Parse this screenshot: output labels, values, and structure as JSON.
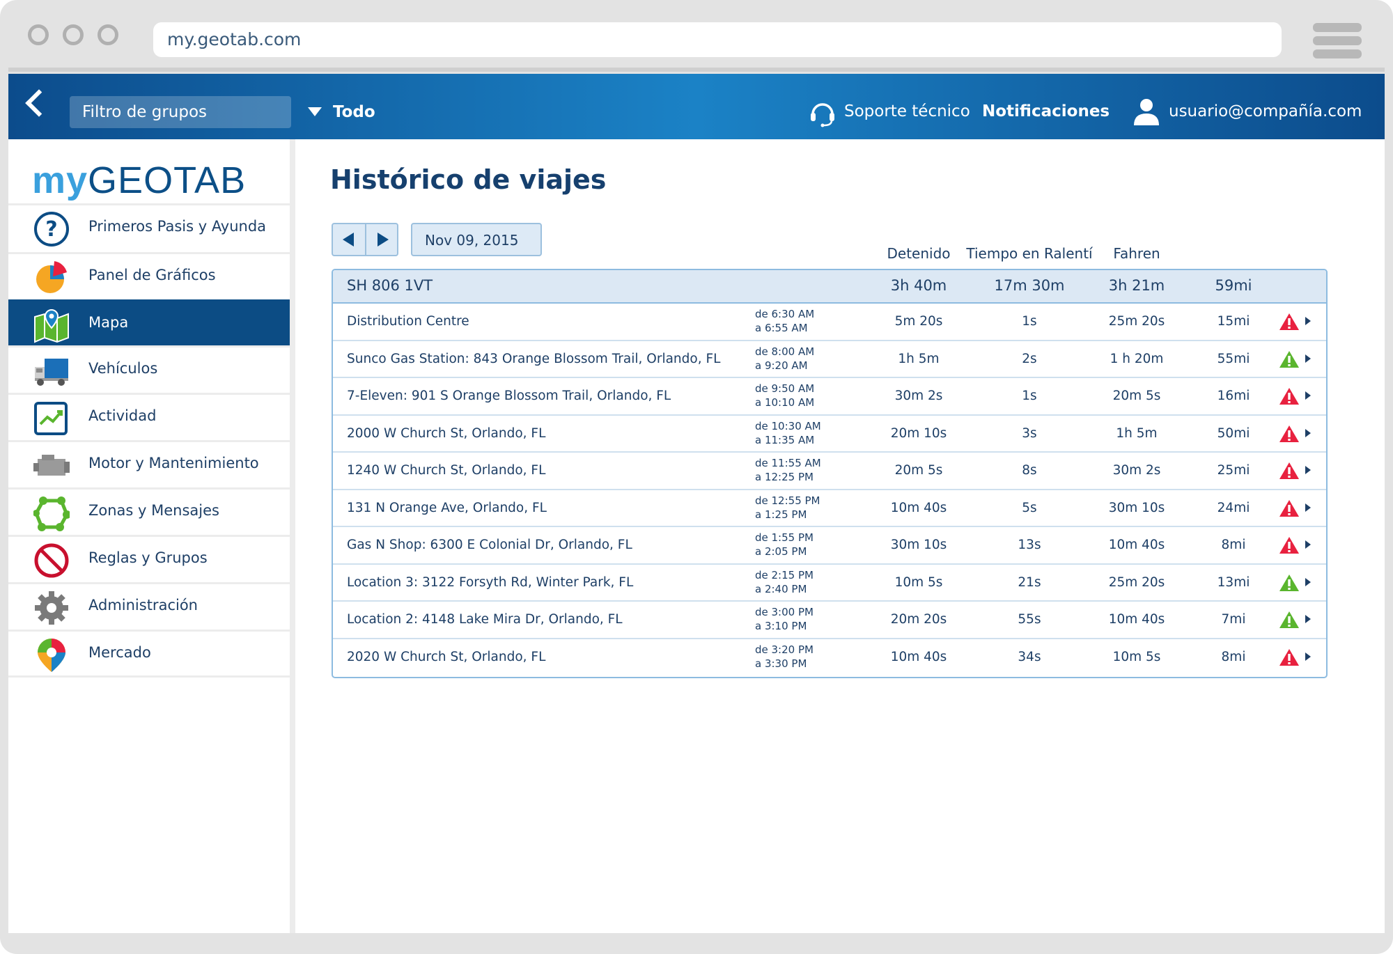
{
  "browser": {
    "url": "my.geotab.com"
  },
  "topbar": {
    "group_filter_placeholder": "Filtro de grupos",
    "scope_label": "Todo",
    "support_label": "Soporte técnico",
    "notifications_label": "Notificaciones",
    "user_label": "usuario@compañía.com"
  },
  "logo": {
    "my": "my",
    "rest": "GEOTAB"
  },
  "sidebar": {
    "items": [
      {
        "label": "Primeros Pasis y Ayunda",
        "icon": "help-icon"
      },
      {
        "label": "Panel de Gráficos",
        "icon": "pie-chart-icon"
      },
      {
        "label": "Mapa",
        "icon": "map-icon",
        "active": true
      },
      {
        "label": "Vehículos",
        "icon": "truck-icon"
      },
      {
        "label": "Actividad",
        "icon": "activity-chart-icon"
      },
      {
        "label": "Motor y Mantenimiento",
        "icon": "engine-icon"
      },
      {
        "label": "Zonas y Mensajes",
        "icon": "zones-icon"
      },
      {
        "label": "Reglas y Grupos",
        "icon": "prohibited-icon"
      },
      {
        "label": "Administración",
        "icon": "gear-icon"
      },
      {
        "label": "Mercado",
        "icon": "marketplace-pin-icon"
      }
    ]
  },
  "main": {
    "title": "Histórico de viajes",
    "date": "Nov 09, 2015",
    "columns": {
      "stopped": "Detenido",
      "idle": "Tiempo en Ralentí",
      "driving": "Fahren"
    }
  },
  "vehicle": {
    "name": "SH 806 1VT",
    "stopped": "3h 40m",
    "idle": "17m 30m",
    "driving": "3h 21m",
    "distance": "59mi"
  },
  "trips": [
    {
      "location": "Distribution Centre",
      "from": "de 6:30 AM",
      "to": "a 6:55 AM",
      "stopped": "5m 20s",
      "idle": "1s",
      "driving": "25m 20s",
      "distance": "15mi",
      "alert": "red"
    },
    {
      "location": "Sunco Gas Station: 843 Orange Blossom Trail, Orlando, FL",
      "from": "de 8:00 AM",
      "to": "a 9:20 AM",
      "stopped": "1h 5m",
      "idle": "2s",
      "driving": "1 h 20m",
      "distance": "55mi",
      "alert": "green"
    },
    {
      "location": "7-Eleven: 901 S Orange Blossom Trail, Orlando, FL",
      "from": "de 9:50 AM",
      "to": "a 10:10 AM",
      "stopped": "30m 2s",
      "idle": "1s",
      "driving": "20m 5s",
      "distance": "16mi",
      "alert": "red"
    },
    {
      "location": "2000 W Church St, Orlando, FL",
      "from": "de 10:30 AM",
      "to": "a 11:35 AM",
      "stopped": "20m 10s",
      "idle": "3s",
      "driving": "1h 5m",
      "distance": "50mi",
      "alert": "red"
    },
    {
      "location": "1240 W Church St, Orlando, FL",
      "from": "de 11:55 AM",
      "to": "a 12:25 PM",
      "stopped": "20m 5s",
      "idle": "8s",
      "driving": "30m 2s",
      "distance": "25mi",
      "alert": "red"
    },
    {
      "location": "131 N Orange Ave, Orlando, FL",
      "from": "de 12:55 PM",
      "to": "a 1:25 PM",
      "stopped": "10m 40s",
      "idle": "5s",
      "driving": "30m 10s",
      "distance": "24mi",
      "alert": "red"
    },
    {
      "location": "Gas N Shop: 6300 E Colonial Dr, Orlando, FL",
      "from": "de 1:55 PM",
      "to": "a 2:05 PM",
      "stopped": "30m 10s",
      "idle": "13s",
      "driving": "10m 40s",
      "distance": "8mi",
      "alert": "red"
    },
    {
      "location": "Location 3: 3122 Forsyth Rd, Winter Park, FL",
      "from": "de 2:15 PM",
      "to": "a 2:40 PM",
      "stopped": "10m 5s",
      "idle": "21s",
      "driving": "25m 20s",
      "distance": "13mi",
      "alert": "green"
    },
    {
      "location": "Location 2: 4148 Lake Mira Dr, Orlando, FL",
      "from": "de 3:00 PM",
      "to": "a 3:10 PM",
      "stopped": "20m 20s",
      "idle": "55s",
      "driving": "10m 40s",
      "distance": "7mi",
      "alert": "green"
    },
    {
      "location": "2020 W Church St, Orlando, FL",
      "from": "de 3:20 PM",
      "to": "a 3:30 PM",
      "stopped": "10m 40s",
      "idle": "34s",
      "driving": "10m 5s",
      "distance": "8mi",
      "alert": "red"
    }
  ],
  "colors": {
    "brand_dark": "#0c4c84",
    "brand_light": "#1b82c6",
    "alert_red": "#e8213f",
    "alert_green": "#5ab52e",
    "text": "#1e3f66"
  }
}
